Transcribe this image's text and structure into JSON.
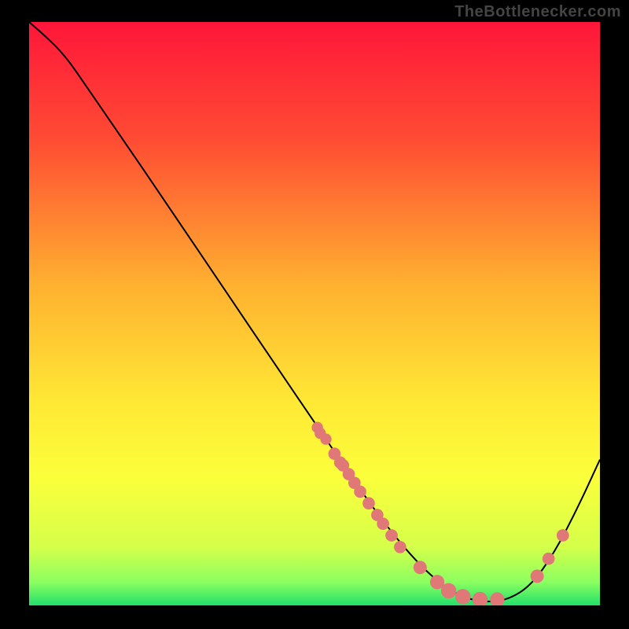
{
  "watermark": "TheBottlenecker.com",
  "chart_data": {
    "type": "line",
    "title": "",
    "xlabel": "",
    "ylabel": "",
    "xlim": [
      0,
      100
    ],
    "ylim": [
      0,
      100
    ],
    "gradient_stops": [
      {
        "offset": 0,
        "color": "#ff163a"
      },
      {
        "offset": 20,
        "color": "#ff4b33"
      },
      {
        "offset": 45,
        "color": "#ffb030"
      },
      {
        "offset": 65,
        "color": "#ffe835"
      },
      {
        "offset": 78,
        "color": "#fbff3a"
      },
      {
        "offset": 90,
        "color": "#d4ff4a"
      },
      {
        "offset": 96,
        "color": "#8cff60"
      },
      {
        "offset": 100,
        "color": "#22e06a"
      }
    ],
    "curve": [
      {
        "x": 0.0,
        "y": 100.0
      },
      {
        "x": 3.0,
        "y": 97.5
      },
      {
        "x": 6.5,
        "y": 94.0
      },
      {
        "x": 10.0,
        "y": 89.0
      },
      {
        "x": 16.0,
        "y": 80.5
      },
      {
        "x": 24.0,
        "y": 69.0
      },
      {
        "x": 34.0,
        "y": 54.5
      },
      {
        "x": 44.0,
        "y": 40.0
      },
      {
        "x": 52.0,
        "y": 28.5
      },
      {
        "x": 60.0,
        "y": 17.0
      },
      {
        "x": 66.0,
        "y": 9.5
      },
      {
        "x": 71.0,
        "y": 4.5
      },
      {
        "x": 75.5,
        "y": 1.5
      },
      {
        "x": 80.0,
        "y": 0.5
      },
      {
        "x": 84.0,
        "y": 1.0
      },
      {
        "x": 88.0,
        "y": 3.5
      },
      {
        "x": 92.0,
        "y": 9.0
      },
      {
        "x": 96.0,
        "y": 16.5
      },
      {
        "x": 100.0,
        "y": 25.0
      }
    ],
    "markers": [
      {
        "x": 50.5,
        "y": 30.5,
        "r": 1.1
      },
      {
        "x": 51.0,
        "y": 29.5,
        "r": 1.1
      },
      {
        "x": 52.0,
        "y": 28.5,
        "r": 1.1
      },
      {
        "x": 53.5,
        "y": 26.0,
        "r": 1.2
      },
      {
        "x": 54.5,
        "y": 24.5,
        "r": 1.2
      },
      {
        "x": 55.0,
        "y": 24.0,
        "r": 1.2
      },
      {
        "x": 56.0,
        "y": 22.5,
        "r": 1.2
      },
      {
        "x": 57.0,
        "y": 21.0,
        "r": 1.2
      },
      {
        "x": 58.0,
        "y": 19.5,
        "r": 1.2
      },
      {
        "x": 59.5,
        "y": 17.5,
        "r": 1.2
      },
      {
        "x": 61.0,
        "y": 15.5,
        "r": 1.2
      },
      {
        "x": 62.0,
        "y": 14.0,
        "r": 1.2
      },
      {
        "x": 63.5,
        "y": 12.0,
        "r": 1.2
      },
      {
        "x": 65.0,
        "y": 10.0,
        "r": 1.2
      },
      {
        "x": 68.5,
        "y": 6.5,
        "r": 1.3
      },
      {
        "x": 71.5,
        "y": 4.0,
        "r": 1.4
      },
      {
        "x": 73.5,
        "y": 2.5,
        "r": 1.5
      },
      {
        "x": 76.0,
        "y": 1.5,
        "r": 1.5
      },
      {
        "x": 79.0,
        "y": 1.0,
        "r": 1.5
      },
      {
        "x": 82.0,
        "y": 1.0,
        "r": 1.4
      },
      {
        "x": 89.0,
        "y": 5.0,
        "r": 1.3
      },
      {
        "x": 91.0,
        "y": 8.0,
        "r": 1.2
      },
      {
        "x": 93.5,
        "y": 12.0,
        "r": 1.2
      }
    ],
    "marker_color": "#e07878",
    "line_color": "#000000"
  }
}
